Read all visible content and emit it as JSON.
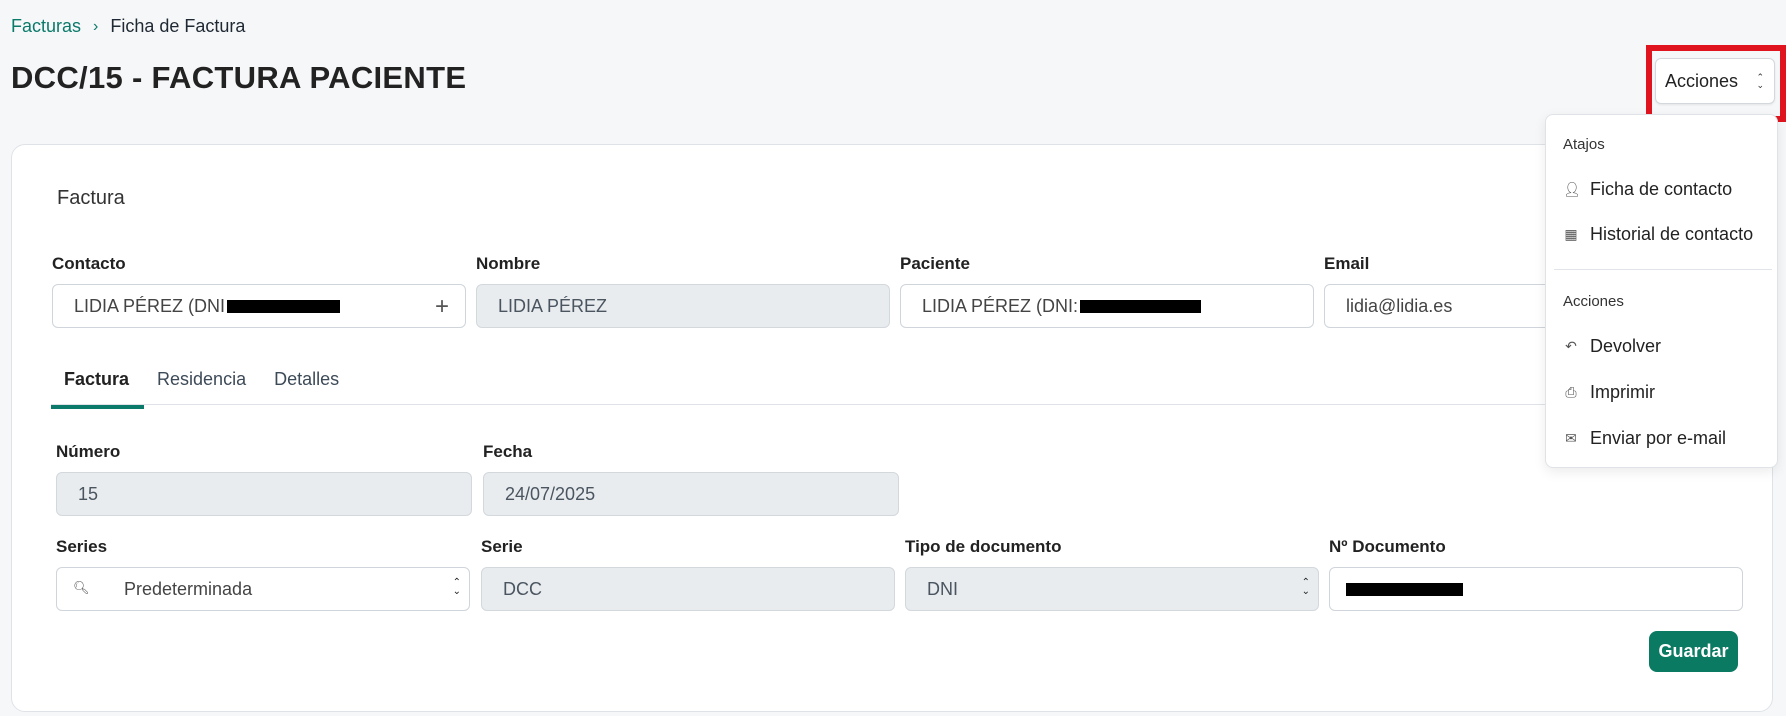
{
  "breadcrumb": {
    "parent": "Facturas",
    "separator": "›",
    "current": "Ficha de Factura"
  },
  "page_title": "DCC/15 - FACTURA PACIENTE",
  "actions_button": {
    "label": "Acciones"
  },
  "card": {
    "title": "Factura"
  },
  "contact_fields": {
    "contacto": {
      "label": "Contacto",
      "value": "LIDIA PÉREZ (DNI"
    },
    "nombre": {
      "label": "Nombre",
      "value": "LIDIA PÉREZ"
    },
    "paciente": {
      "label": "Paciente",
      "value": "LIDIA PÉREZ (DNI:"
    },
    "email": {
      "label": "Email",
      "value": "lidia@lidia.es"
    }
  },
  "tabs": [
    {
      "label": "Factura",
      "active": true
    },
    {
      "label": "Residencia",
      "active": false
    },
    {
      "label": "Detalles",
      "active": false
    }
  ],
  "invoice_fields": {
    "numero": {
      "label": "Número",
      "value": "15"
    },
    "fecha": {
      "label": "Fecha",
      "value": "24/07/2025"
    },
    "series": {
      "label": "Series",
      "value": "Predeterminada"
    },
    "serie": {
      "label": "Serie",
      "value": "DCC"
    },
    "tipo_documento": {
      "label": "Tipo de documento",
      "value": "DNI"
    },
    "n_documento": {
      "label": "Nº Documento",
      "value": ""
    }
  },
  "save_button": {
    "label": "Guardar"
  },
  "actions_menu": {
    "shortcuts_title": "Atajos",
    "shortcuts": [
      {
        "label": "Ficha de contacto",
        "icon": "person-icon"
      },
      {
        "label": "Historial de contacto",
        "icon": "calendar-icon"
      }
    ],
    "actions_title": "Acciones",
    "actions": [
      {
        "label": "Devolver",
        "icon": "undo-icon"
      },
      {
        "label": "Imprimir",
        "icon": "printer-icon"
      },
      {
        "label": "Enviar por e-mail",
        "icon": "mail-icon"
      }
    ]
  },
  "colors": {
    "accent": "#0b7a6a",
    "highlight": "#e0141e"
  }
}
